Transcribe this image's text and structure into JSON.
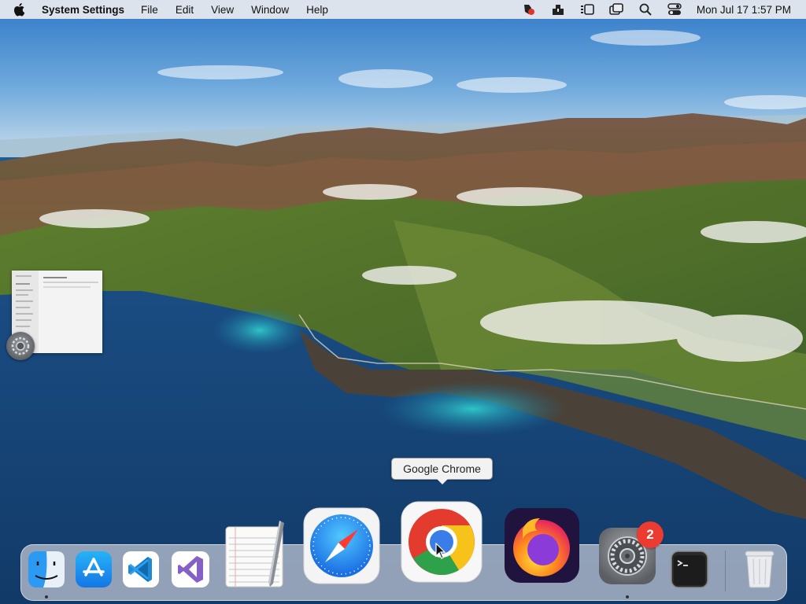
{
  "menubar": {
    "app_name": "System Settings",
    "menus": [
      "File",
      "Edit",
      "View",
      "Window",
      "Help"
    ],
    "status_icons": [
      "screen-record-icon",
      "dropbox-icon",
      "stage-manager-icon",
      "screen-mirroring-icon",
      "spotlight-search-icon",
      "control-center-icon"
    ],
    "clock": "Mon Jul 17  1:57 PM"
  },
  "desktop": {
    "wallpaper": "macOS Big Sur coastline",
    "minimized_window": "System Settings"
  },
  "tooltip": {
    "text": "Google Chrome"
  },
  "dock": {
    "items": [
      {
        "name": "Finder",
        "icon": "finder-icon",
        "running": true
      },
      {
        "name": "App Store",
        "icon": "app-store-icon",
        "running": false
      },
      {
        "name": "Visual Studio Code",
        "icon": "vscode-icon",
        "running": false
      },
      {
        "name": "Visual Studio",
        "icon": "visual-studio-icon",
        "running": false
      },
      {
        "name": "TextEdit",
        "icon": "textedit-icon",
        "running": false
      },
      {
        "name": "Safari",
        "icon": "safari-icon",
        "running": false
      },
      {
        "name": "Google Chrome",
        "icon": "chrome-icon",
        "running": false
      },
      {
        "name": "Firefox",
        "icon": "firefox-icon",
        "running": false
      },
      {
        "name": "System Settings",
        "icon": "system-settings-icon",
        "running": true,
        "badge": "2"
      },
      {
        "name": "Terminal",
        "icon": "terminal-icon",
        "running": false
      },
      {
        "name": "Trash",
        "icon": "trash-icon",
        "running": false
      }
    ]
  },
  "colors": {
    "badge": "#ec3b30",
    "menubar": "#ececf0",
    "sea": "#1b4f86"
  }
}
